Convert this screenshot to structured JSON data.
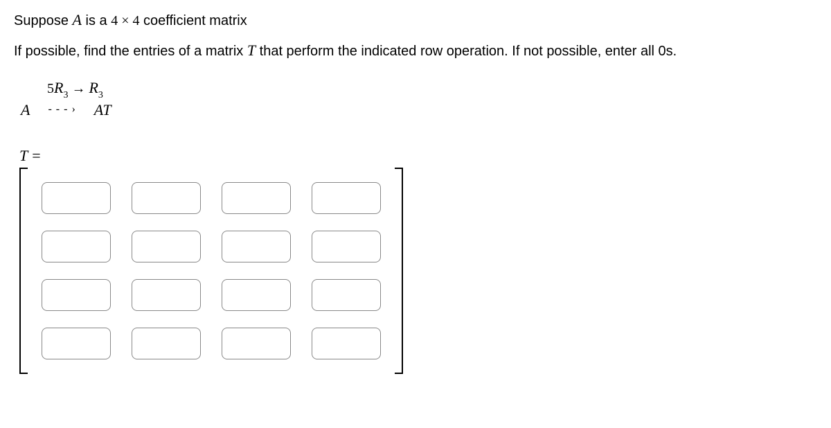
{
  "problem": {
    "line1_pre": "Suppose ",
    "line1_A": "A",
    "line1_mid": " is a ",
    "line1_dim": "4 × 4",
    "line1_post": " coefficient matrix",
    "line2_pre": "If possible, find the entries of a matrix ",
    "line2_T": "T",
    "line2_post": " that perform the indicated row operation. If not possible, enter all 0s."
  },
  "operation": {
    "row_op_lhs_coef": "5",
    "row_op_lhs_R": "R",
    "row_op_lhs_sub": "3",
    "row_op_arrow": " → ",
    "row_op_rhs_R": "R",
    "row_op_rhs_sub": "3",
    "A": "A",
    "dashes": "- - - ›",
    "AT": "AT"
  },
  "answer": {
    "T": "T",
    "equals": "=",
    "rows": 4,
    "cols": 4,
    "cells": [
      [
        "",
        "",
        "",
        ""
      ],
      [
        "",
        "",
        "",
        ""
      ],
      [
        "",
        "",
        "",
        ""
      ],
      [
        "",
        "",
        "",
        ""
      ]
    ]
  }
}
